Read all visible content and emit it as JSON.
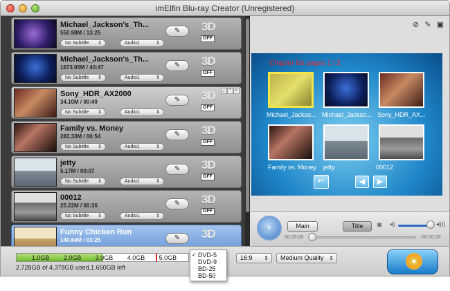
{
  "window": {
    "title": "imElfin Blu-ray Creator (Unregistered)"
  },
  "list": {
    "subtitle_default": "No Subtitle",
    "audio_default": "Audio1",
    "three_d_label": "3D",
    "off_label": "OFF",
    "items": [
      {
        "name": "Michael_Jackson's_Th...",
        "meta": "550.98M / 13:25",
        "subtitle": "No Subtitle",
        "audio": "Audio1",
        "three_d": "3D",
        "toggle": "OFF",
        "edit": "✎"
      },
      {
        "name": "Michael_Jackson's_Th...",
        "meta": "1673.05M / 40:47",
        "subtitle": "No Subtitle",
        "audio": "Audio1",
        "three_d": "3D",
        "toggle": "OFF",
        "edit": "✎"
      },
      {
        "name": "Sony_HDR_AX2000",
        "meta": "34.10M / 00:49",
        "subtitle": "No Subtitle",
        "audio": "Audio1",
        "three_d": "3D",
        "toggle": "OFF",
        "edit": "✎"
      },
      {
        "name": "Family vs. Money",
        "meta": "283.33M / 06:54",
        "subtitle": "No Subtitle",
        "audio": "Audio1",
        "three_d": "3D",
        "toggle": "OFF",
        "edit": "✎"
      },
      {
        "name": "jetty",
        "meta": "5.17M / 00:07",
        "subtitle": "No Subtitle",
        "audio": "Audio1",
        "three_d": "3D",
        "toggle": "OFF",
        "edit": "✎"
      },
      {
        "name": "00012",
        "meta": "25.22M / 00:36",
        "subtitle": "No Subtitle",
        "audio": "Audio1",
        "three_d": "3D",
        "toggle": "OFF",
        "edit": "✎"
      },
      {
        "name": "Funny Chicken Run",
        "meta": "140.64M / 03:25",
        "subtitle": "",
        "audio": "",
        "three_d": "3D",
        "toggle": "",
        "edit": "✎"
      }
    ]
  },
  "preview": {
    "chapter_label": "Chapter list pages 1 / 2",
    "chapters": [
      {
        "caption": "Michael_Jackso..."
      },
      {
        "caption": "Michael_Jackso..."
      },
      {
        "caption": "Sony_HDR_AX..."
      },
      {
        "caption": "Family vs. Money"
      },
      {
        "caption": "jetty"
      },
      {
        "caption": "00012"
      }
    ],
    "back_symbol": "↩",
    "prev_symbol": "◀",
    "next_symbol": "▶"
  },
  "controls": {
    "main_label": "Main",
    "title_label": "Title",
    "time_start": "00:00:00",
    "time_end": "-00:00:00",
    "volume_fraction": 0.85,
    "seek_fraction": 0.0
  },
  "bottom": {
    "ticks": [
      "1.0GB",
      "2.0GB",
      "3.0GB",
      "4.0GB",
      "5.0GB"
    ],
    "usage_text": "2.728GB of 4.378GB used,1.650GB left",
    "used_gb": 2.728,
    "capacity_gb": 4.378,
    "scale_max_gb": 5.4,
    "ratio": "16:9",
    "quality": "Medium Quality",
    "disc_options": [
      "DVD-5",
      "DVD-9",
      "BD-25",
      "BD-50"
    ],
    "disc_selected": "DVD-5"
  },
  "icons": {
    "toolbar": [
      "no-subtitle-icon",
      "edit-icon",
      "snapshot-icon"
    ],
    "edit_glyph": "✎",
    "check_glyph": "✓",
    "arrows_glyph": "⇕",
    "camera_glyph": "◙",
    "vol_low": "◂)",
    "vol_high": "◂)))"
  },
  "colors": {
    "accent_blue": "#1e86c8",
    "chapter_label_red": "#e8262b",
    "capacity_green": "#6dbb2a",
    "selected_item": "#5e8fd3"
  }
}
